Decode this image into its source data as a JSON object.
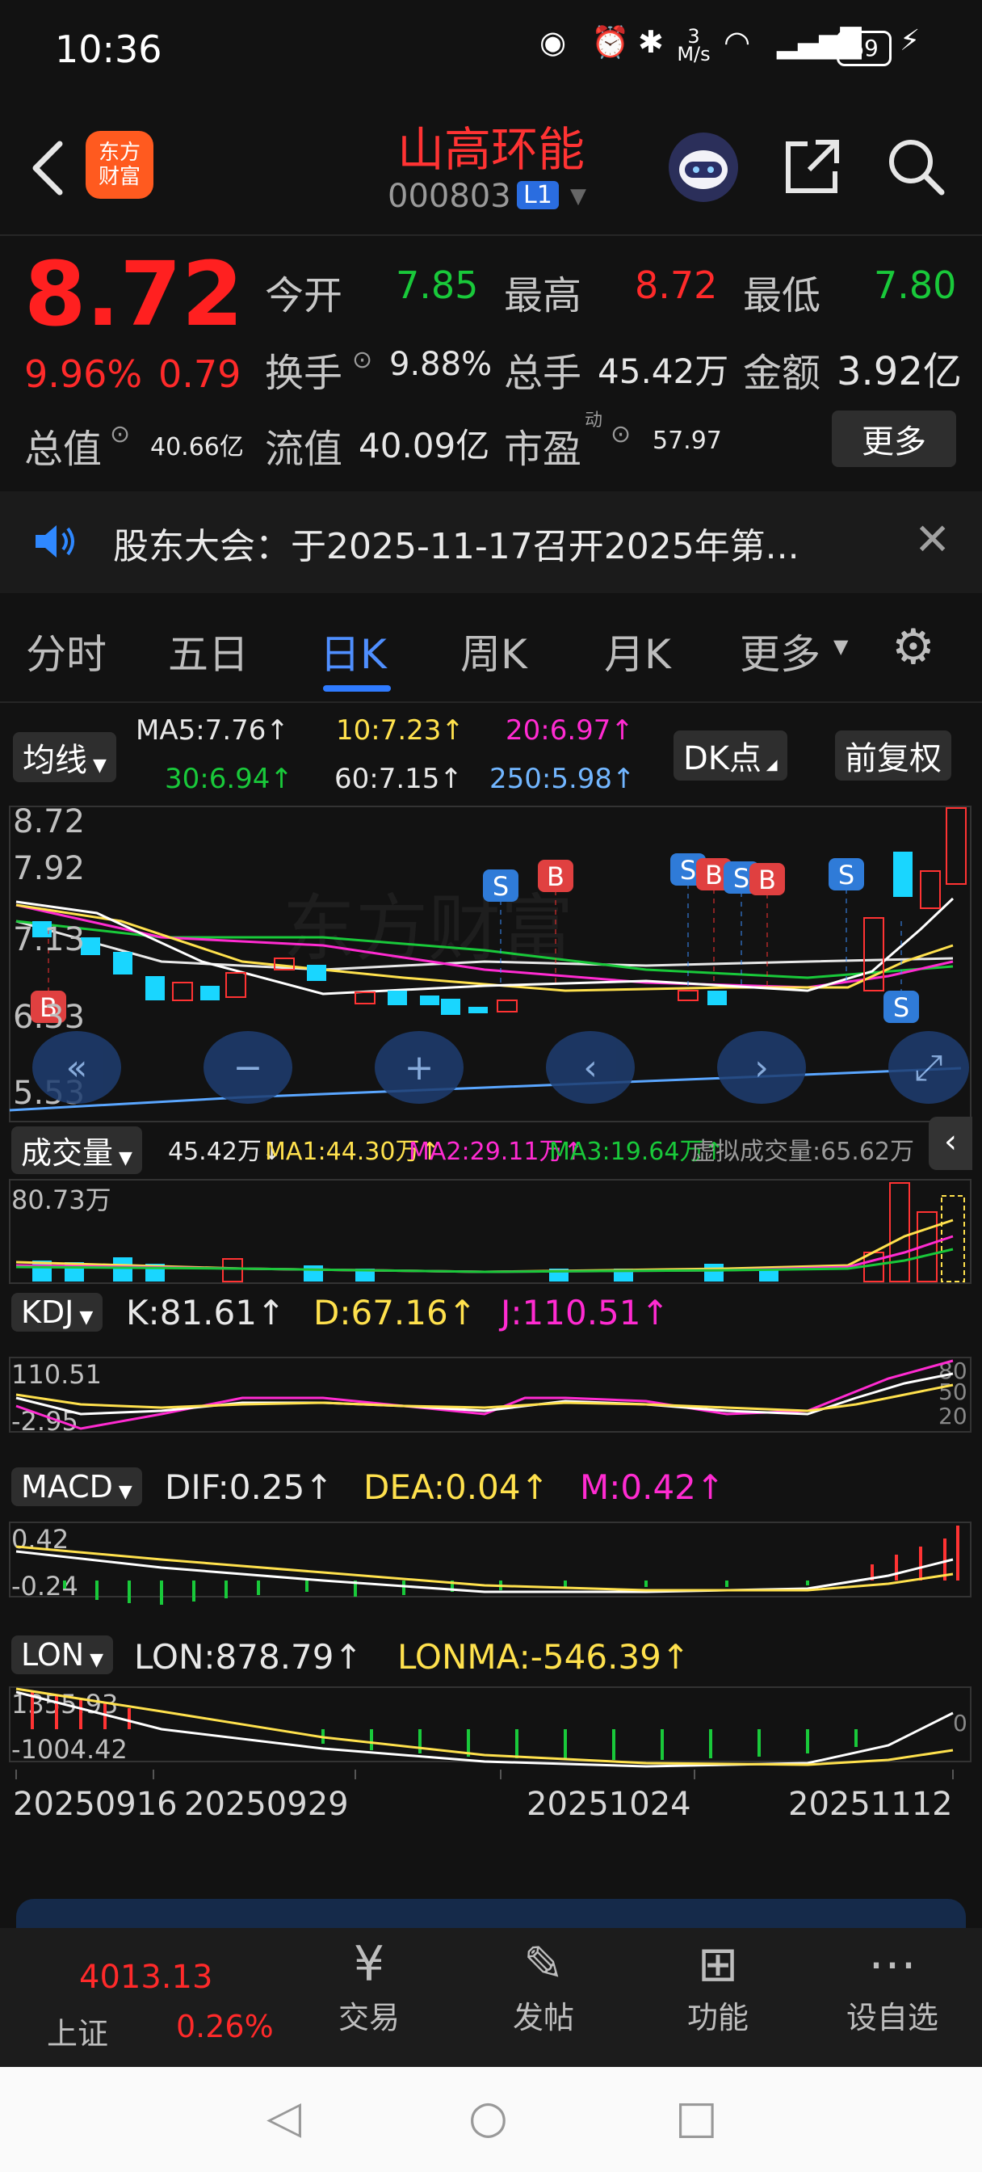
{
  "status_bar": {
    "time": "10:36",
    "net_speed": "3 M/s",
    "battery": "69"
  },
  "header": {
    "logo_line1": "东方",
    "logo_line2": "财富",
    "stock_name": "山高环能",
    "stock_code": "000803",
    "level_badge": "L1"
  },
  "quote": {
    "price": "8.72",
    "change_pct": "9.96%",
    "change_abs": "0.79",
    "open_label": "今开",
    "open": "7.85",
    "high_label": "最高",
    "high": "8.72",
    "low_label": "最低",
    "low": "7.80",
    "turnover_label": "换手",
    "turnover": "9.88%",
    "volume_label": "总手",
    "volume": "45.42万",
    "amount_label": "金额",
    "amount": "3.92亿",
    "mktcap_label": "总值",
    "mktcap": "40.66亿",
    "float_label": "流值",
    "float_cap": "40.09亿",
    "pe_label": "市盈",
    "pe_sup": "动",
    "pe": "57.97",
    "more_button": "更多"
  },
  "notice": {
    "text": "股东大会：于2025-11-17召开2025年第..."
  },
  "tabs": [
    {
      "label": "分时"
    },
    {
      "label": "五日"
    },
    {
      "label": "日K"
    },
    {
      "label": "周K"
    },
    {
      "label": "月K"
    },
    {
      "label": "更多"
    }
  ],
  "kline": {
    "indicator_select": "均线",
    "ma5": "MA5:7.76↑",
    "ma10": "10:7.23↑",
    "ma20": "20:6.97↑",
    "ma30": "30:6.94↑",
    "ma60": "60:7.15↑",
    "ma250": "250:5.98↑",
    "dk_button": "DK点",
    "adjust_button": "前复权",
    "y_labels": [
      "8.72",
      "7.92",
      "7.13",
      "6.33",
      "5.53"
    ],
    "signals": [
      "S",
      "B",
      "S",
      "B",
      "S",
      "B",
      "S",
      "S",
      "B"
    ]
  },
  "volume": {
    "select": "成交量",
    "vol": "45.42万↓",
    "ma1": "MA1:44.30万↑",
    "ma2": "MA2:29.11万↑",
    "ma3": "MA3:19.64万↑",
    "virtual": "虚拟成交量:65.62万",
    "max_label": "80.73万"
  },
  "kdj": {
    "select": "KDJ",
    "k": "K:81.61↑",
    "d": "D:67.16↑",
    "j": "J:110.51↑",
    "max_label": "110.51",
    "min_label": "-2.95",
    "levels": [
      "80",
      "50",
      "20"
    ]
  },
  "macd": {
    "select": "MACD",
    "dif": "DIF:0.25↑",
    "dea": "DEA:0.04↑",
    "m": "M:0.42↑",
    "max_label": "0.42",
    "min_label": "-0.24"
  },
  "lon": {
    "select": "LON",
    "lon": "LON:878.79↑",
    "lonma": "LONMA:-546.39↑",
    "max_label": "1355.93",
    "min_label": "-1004.42",
    "zero": "0"
  },
  "x_axis": [
    "20250916",
    "20250929",
    "20251024",
    "20251112"
  ],
  "bottom_nav": {
    "index_value": "4013.13",
    "index_name": "上证",
    "index_change": "0.26%",
    "items": [
      {
        "label": "交易"
      },
      {
        "label": "发帖"
      },
      {
        "label": "功能"
      },
      {
        "label": "设自选"
      }
    ]
  },
  "colors": {
    "up": "#ff2a2a",
    "down": "#19c93a",
    "accent": "#2f7bff"
  }
}
